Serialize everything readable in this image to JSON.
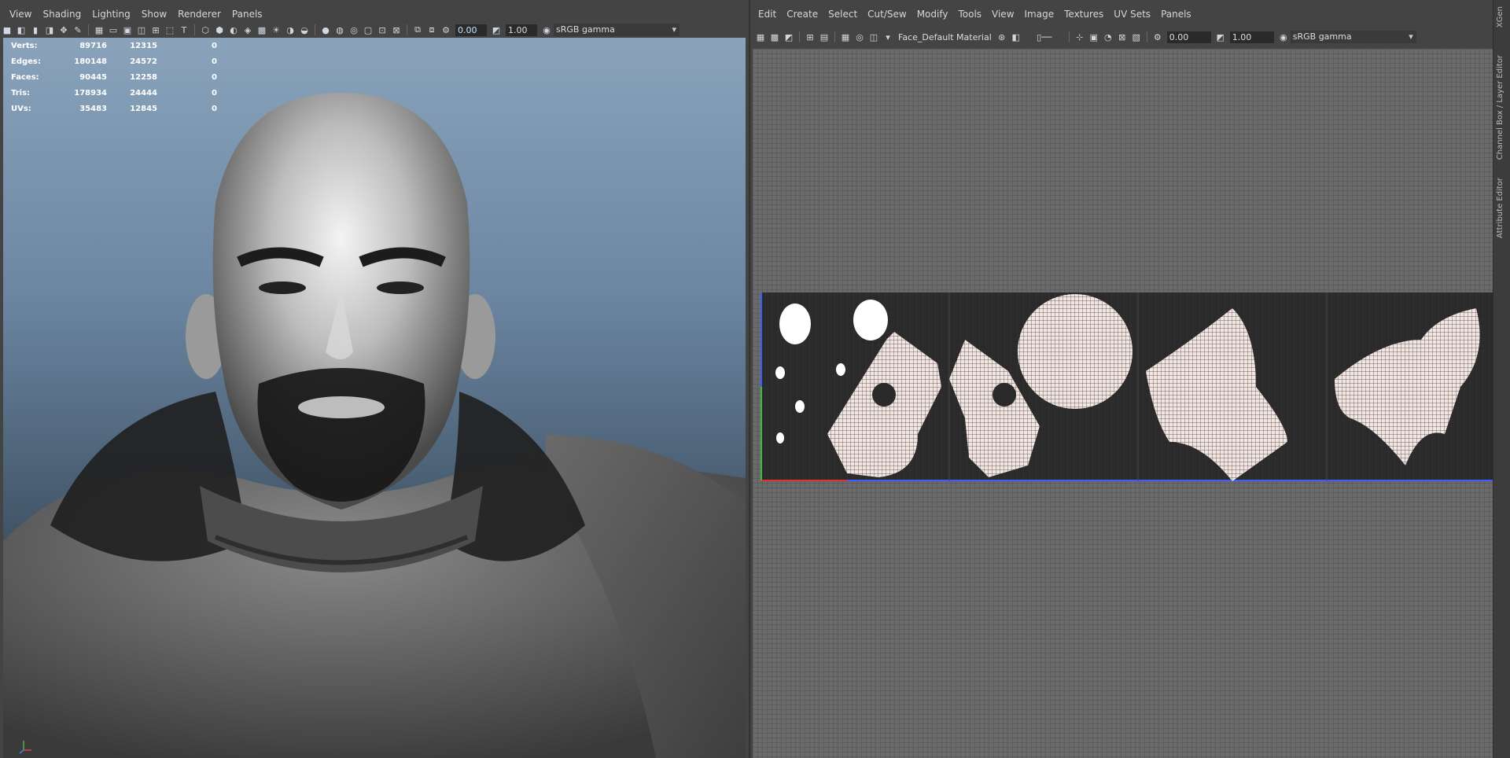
{
  "viewport_left": {
    "menu": [
      "View",
      "Shading",
      "Lighting",
      "Show",
      "Renderer",
      "Panels"
    ],
    "toolbar": {
      "value_a": "0.00",
      "value_b": "1.00",
      "colorspace": "sRGB gamma"
    },
    "stats": [
      {
        "label": "Verts:",
        "v1": "89716",
        "v2": "12315",
        "v3": "0"
      },
      {
        "label": "Edges:",
        "v1": "180148",
        "v2": "24572",
        "v3": "0"
      },
      {
        "label": "Faces:",
        "v1": "90445",
        "v2": "12258",
        "v3": "0"
      },
      {
        "label": "Tris:",
        "v1": "178934",
        "v2": "24444",
        "v3": "0"
      },
      {
        "label": "UVs:",
        "v1": "35483",
        "v2": "12845",
        "v3": "0"
      }
    ]
  },
  "uv_editor": {
    "menu": [
      "Edit",
      "Create",
      "Select",
      "Cut/Sew",
      "Modify",
      "Tools",
      "View",
      "Image",
      "Textures",
      "UV Sets",
      "Panels"
    ],
    "toolbar": {
      "material": "Face_Default Material",
      "value_a": "0.00",
      "value_b": "1.00",
      "colorspace": "sRGB gamma"
    }
  },
  "side_tabs": [
    "XGen",
    "Channel Box / Layer Editor",
    "Attribute Editor"
  ],
  "colors": {
    "accent_field_text": "#bfe3ff",
    "uv_wire": "#f2e6e2",
    "uv_tile_bg": "#2a2a2a"
  }
}
